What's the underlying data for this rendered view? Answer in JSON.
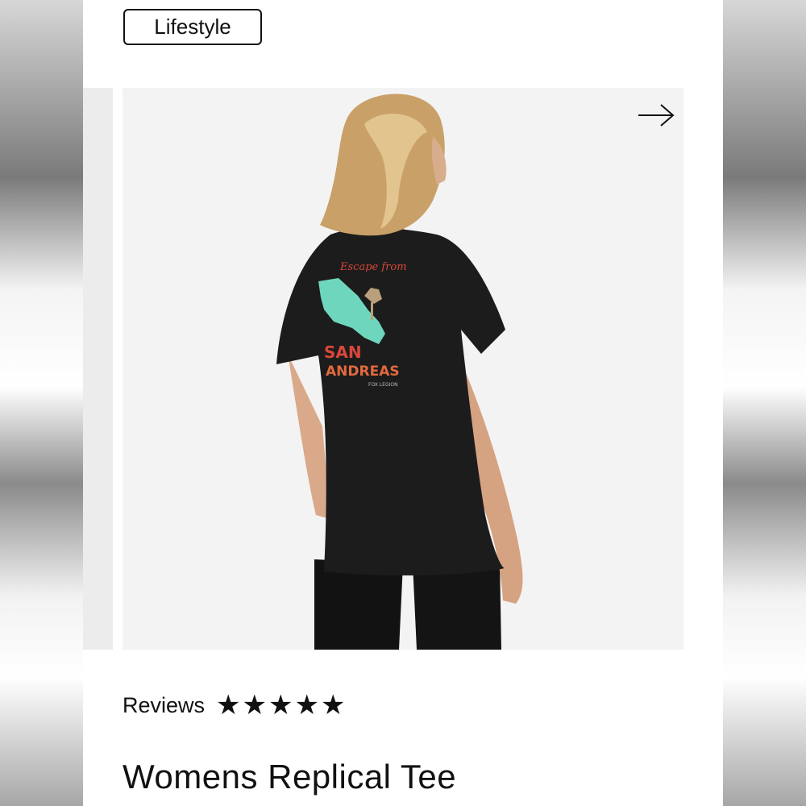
{
  "category_badge": "Lifestyle",
  "gallery": {
    "image_alt": "Woman from behind wearing black tee with 'Escape from San Andreas' back graphic",
    "graphic_text_top": "Escape from",
    "graphic_text_main_1": "SAN",
    "graphic_text_main_2": "ANDREAS",
    "graphic_text_small": "FOX LEGION",
    "next_icon": "arrow-right-icon"
  },
  "reviews": {
    "label": "Reviews",
    "rating": 5,
    "max_rating": 5
  },
  "product": {
    "title": "Womens Replical Tee"
  },
  "colors": {
    "shirt": "#1c1c1c",
    "graphic_teal": "#6fd6be",
    "graphic_red": "#d9473a",
    "background": "#f3f3f3"
  }
}
